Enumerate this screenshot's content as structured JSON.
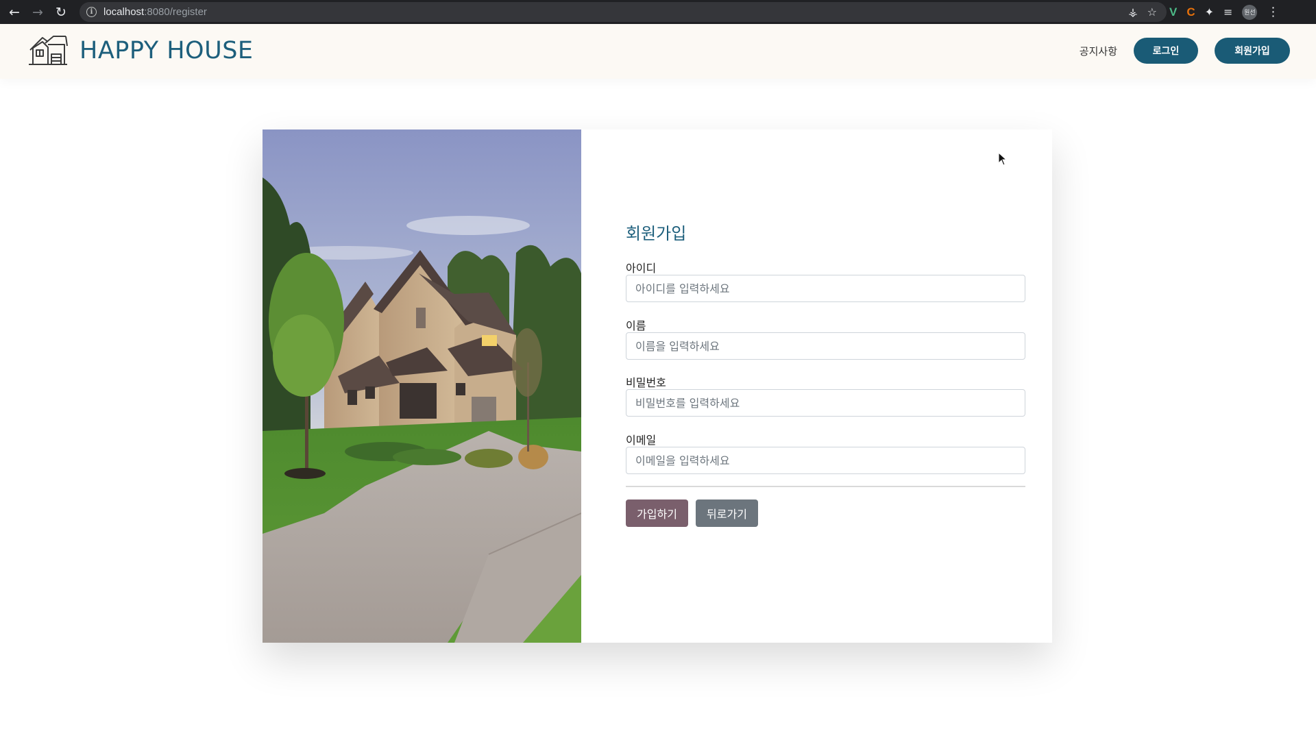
{
  "browser": {
    "url_host": "localhost",
    "url_rest": ":8080/register",
    "profile_label": "원선"
  },
  "header": {
    "brand": "HAPPY HOUSE",
    "nav_notice": "공지사항",
    "login_label": "로그인",
    "register_label": "회원가입",
    "accent_color": "#1a5b76"
  },
  "form": {
    "title": "회원가입",
    "fields": [
      {
        "label": "아이디",
        "placeholder": "아이디를 입력하세요",
        "value": ""
      },
      {
        "label": "이름",
        "placeholder": "이름을 입력하세요",
        "value": ""
      },
      {
        "label": "비밀번호",
        "placeholder": "비밀번호를 입력하세요",
        "value": ""
      },
      {
        "label": "이메일",
        "placeholder": "이메일을 입력하세요",
        "value": ""
      }
    ],
    "submit_label": "가입하기",
    "back_label": "뒤로가기",
    "submit_color": "#7a5f6c",
    "back_color": "#6c757d"
  },
  "icons": [
    "back-arrow-icon",
    "forward-arrow-icon",
    "reload-icon",
    "info-icon",
    "key-icon",
    "star-icon",
    "vue-devtools-icon",
    "extension-c-icon",
    "puzzle-icon",
    "media-queue-icon",
    "menu-kebab-icon",
    "house-logo-icon",
    "mouse-cursor-icon"
  ]
}
